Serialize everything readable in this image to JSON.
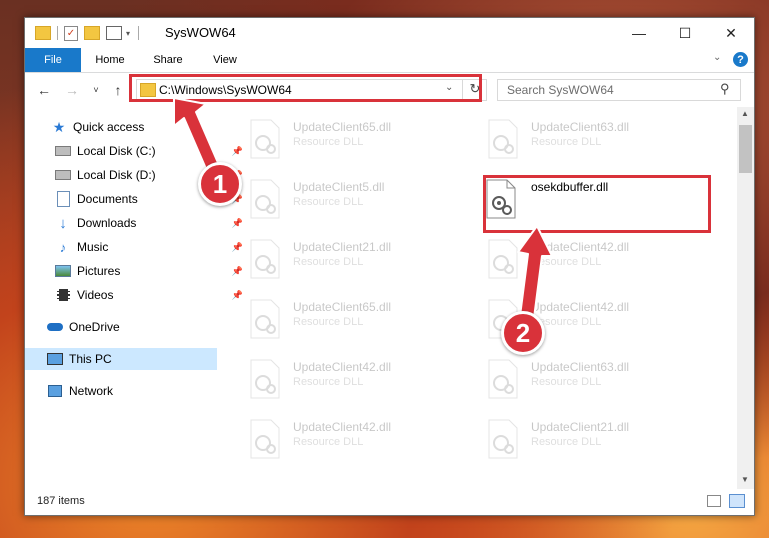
{
  "window": {
    "title": "SysWOW64",
    "minimize_glyph": "—",
    "maximize_glyph": "☐",
    "close_glyph": "✕"
  },
  "ribbon": {
    "tabs": [
      {
        "label": "File"
      },
      {
        "label": "Home"
      },
      {
        "label": "Share"
      },
      {
        "label": "View"
      }
    ]
  },
  "navigation": {
    "address": "C:\\Windows\\SysWOW64",
    "search_placeholder": "Search SysWOW64"
  },
  "sidebar": {
    "items": [
      {
        "label": "Quick access",
        "icon": "star-icon"
      },
      {
        "label": "Local Disk (C:)",
        "icon": "drive-icon"
      },
      {
        "label": "Local Disk (D:)",
        "icon": "drive-icon"
      },
      {
        "label": "Documents",
        "icon": "documents-icon"
      },
      {
        "label": "Downloads",
        "icon": "download-icon"
      },
      {
        "label": "Music",
        "icon": "music-icon"
      },
      {
        "label": "Pictures",
        "icon": "pictures-icon"
      },
      {
        "label": "Videos",
        "icon": "videos-icon"
      },
      {
        "label": "OneDrive",
        "icon": "cloud-icon"
      },
      {
        "label": "This PC",
        "icon": "computer-icon",
        "selected": true
      },
      {
        "label": "Network",
        "icon": "network-icon"
      }
    ]
  },
  "files": {
    "highlighted": {
      "name": "osekdbuffer.dll"
    },
    "items": [
      {
        "name": "UpdateClient65.dll",
        "desc": "Resource DLL"
      },
      {
        "name": "UpdateClient63.dll",
        "desc": "Resource DLL"
      },
      {
        "name": "UpdateClient5.dll",
        "desc": "Resource DLL"
      },
      {
        "name": "UpdateClient21.dll",
        "desc": "Resource DLL"
      },
      {
        "name": "UpdateClient42.dll",
        "desc": "Resource DLL"
      },
      {
        "name": "UpdateClient65.dll",
        "desc": "Resource DLL"
      },
      {
        "name": "UpdateClient42.dll",
        "desc": "Resource DLL"
      },
      {
        "name": "UpdateClient42.dll",
        "desc": "Resource DLL"
      },
      {
        "name": "UpdateClient63.dll",
        "desc": "Resource DLL"
      },
      {
        "name": "UpdateClient42.dll",
        "desc": "Resource DLL"
      },
      {
        "name": "UpdateClient21.dll",
        "desc": "Resource DLL"
      }
    ]
  },
  "status": {
    "item_count": "187 items"
  },
  "callouts": [
    {
      "number": "1"
    },
    {
      "number": "2"
    }
  ],
  "colors": {
    "accent": "#1979ca",
    "highlight": "#d9323a",
    "selection": "#cce8ff"
  }
}
